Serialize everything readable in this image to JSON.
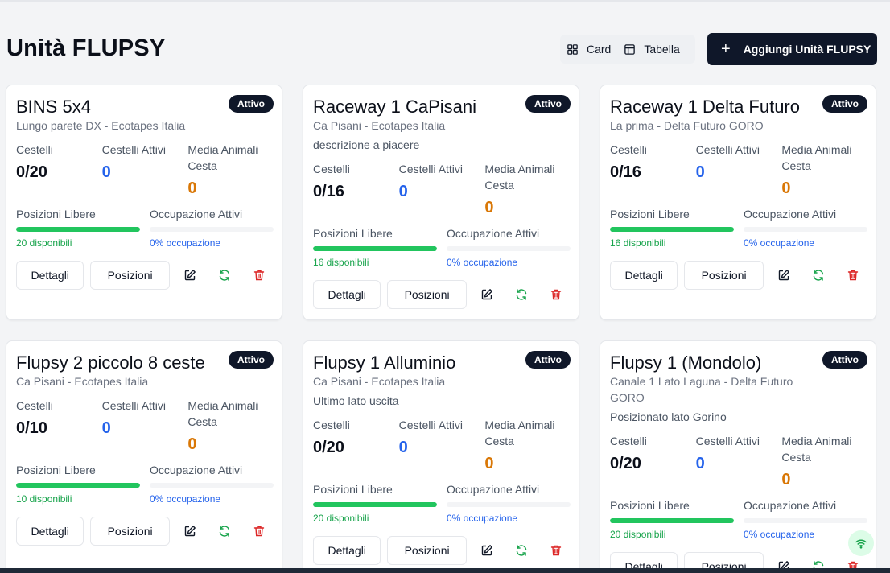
{
  "header": {
    "title": "Unità FLUPSY",
    "view_card": "Card",
    "view_table": "Tabella",
    "add_button": "Aggiungi Unità FLUPSY",
    "add_icon": "+"
  },
  "labels": {
    "cestelli": "Cestelli",
    "cestelli_attivi": "Cestelli Attivi",
    "media_animali": "Media Animali Cesta",
    "posizioni_libere": "Posizioni Libere",
    "occupazione_attivi": "Occupazione Attivi",
    "dettagli": "Dettagli",
    "posizioni": "Posizioni"
  },
  "colors": {
    "primary_dark": "#0f1729",
    "green": "#22c55e",
    "blue": "#2563eb",
    "orange": "#d97706",
    "red": "#dc2626"
  },
  "cards": [
    {
      "title": "BINS 5x4",
      "status": "Attivo",
      "subtitle": "Lungo parete DX - Ecotapes Italia",
      "description": "",
      "cestelli": "0/20",
      "cestelli_attivi": "0",
      "media_animali": "0",
      "free_fraction": 1.0,
      "free_note": "20 disponibili",
      "occ_fraction": 0.0,
      "occ_note": "0% occupazione"
    },
    {
      "title": "Raceway 1 CaPisani",
      "status": "Attivo",
      "subtitle": "Ca Pisani - Ecotapes Italia",
      "description": "descrizione a piacere",
      "cestelli": "0/16",
      "cestelli_attivi": "0",
      "media_animali": "0",
      "free_fraction": 1.0,
      "free_note": "16 disponibili",
      "occ_fraction": 0.0,
      "occ_note": "0% occupazione"
    },
    {
      "title": "Raceway 1 Delta Futuro",
      "status": "Attivo",
      "subtitle": "La prima - Delta Futuro GORO",
      "description": "",
      "cestelli": "0/16",
      "cestelli_attivi": "0",
      "media_animali": "0",
      "free_fraction": 1.0,
      "free_note": "16 disponibili",
      "occ_fraction": 0.0,
      "occ_note": "0% occupazione"
    },
    {
      "title": "Flupsy 2 piccolo 8 ceste",
      "status": "Attivo",
      "subtitle": "Ca Pisani - Ecotapes Italia",
      "description": "",
      "cestelli": "0/10",
      "cestelli_attivi": "0",
      "media_animali": "0",
      "free_fraction": 1.0,
      "free_note": "10 disponibili",
      "occ_fraction": 0.0,
      "occ_note": "0% occupazione"
    },
    {
      "title": "Flupsy 1 Alluminio",
      "status": "Attivo",
      "subtitle": "Ca Pisani - Ecotapes Italia",
      "description": "Ultimo lato uscita",
      "cestelli": "0/20",
      "cestelli_attivi": "0",
      "media_animali": "0",
      "free_fraction": 1.0,
      "free_note": "20 disponibili",
      "occ_fraction": 0.0,
      "occ_note": "0% occupazione"
    },
    {
      "title": "Flupsy 1 (Mondolo)",
      "status": "Attivo",
      "subtitle": "Canale 1 Lato Laguna - Delta Futuro GORO",
      "description": "Posizionato lato Gorino",
      "cestelli": "0/20",
      "cestelli_attivi": "0",
      "media_animali": "0",
      "free_fraction": 1.0,
      "free_note": "20 disponibili",
      "occ_fraction": 0.0,
      "occ_note": "0% occupazione"
    }
  ],
  "icons": {
    "grid": "grid-icon",
    "table": "table-icon",
    "edit": "edit-icon",
    "refresh": "refresh-icon",
    "delete": "trash-icon",
    "wifi": "wifi-icon"
  }
}
